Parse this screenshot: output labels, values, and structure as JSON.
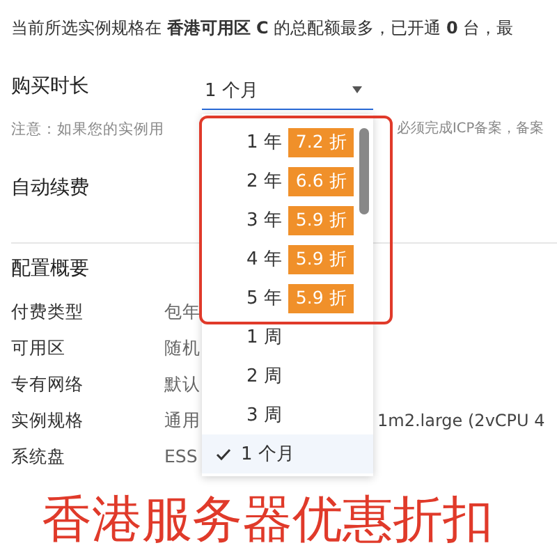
{
  "quota_notice": {
    "text": "当前所选实例规格在 **香港可用区 C** 的总配额最多，已开通 **0** 台，最"
  },
  "duration": {
    "label": "购买时长",
    "value": "1 个月"
  },
  "icp_note": {
    "before": "注意：如果您的实例用",
    "after": "必须完成ICP备案，备案"
  },
  "auto_renew": {
    "label": "自动续费"
  },
  "summary": {
    "title": "配置概要",
    "rows": [
      {
        "label": "付费类型",
        "value": "包年"
      },
      {
        "label": "可用区",
        "value": "随机"
      },
      {
        "label": "专有网络",
        "value": "默认"
      },
      {
        "label": "实例规格",
        "value": "通用",
        "extra": "1m2.large (2vCPU 4"
      },
      {
        "label": "系统盘",
        "value": "ESS"
      }
    ]
  },
  "dropdown": {
    "options": [
      {
        "label": "1 年",
        "discount": "7.2 折",
        "selected": false
      },
      {
        "label": "2 年",
        "discount": "6.6 折",
        "selected": false
      },
      {
        "label": "3 年",
        "discount": "5.9 折",
        "selected": false
      },
      {
        "label": "4 年",
        "discount": "5.9 折",
        "selected": false
      },
      {
        "label": "5 年",
        "discount": "5.9 折",
        "selected": false
      },
      {
        "label": "1 周",
        "selected": false
      },
      {
        "label": "2 周",
        "selected": false
      },
      {
        "label": "3 周",
        "selected": false
      },
      {
        "label": "1 个月",
        "selected": true
      }
    ]
  },
  "annotation": {
    "text": "香港服务器优惠折扣"
  }
}
